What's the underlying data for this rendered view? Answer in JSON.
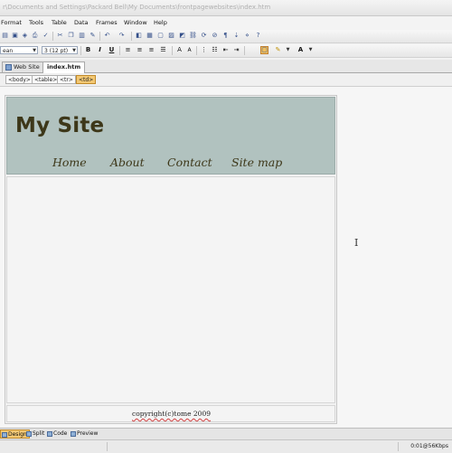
{
  "window": {
    "title": "r\\Documents and Settings\\Packard Bell\\My Documents\\frontpagewebsites\\index.htm"
  },
  "menu": {
    "items": [
      "Format",
      "Tools",
      "Table",
      "Data",
      "Frames",
      "Window",
      "Help"
    ]
  },
  "format_toolbar": {
    "style_value": "ean",
    "size_value": "3 (12 pt)",
    "bold": "B",
    "italic": "I",
    "underline": "U"
  },
  "tabs": [
    {
      "label": "Web Site"
    },
    {
      "label": "index.htm"
    }
  ],
  "tag_selector": [
    "<body>",
    "<table>",
    "<tr>",
    "<td>"
  ],
  "page": {
    "site_title": "My Site",
    "nav": [
      "Home",
      "About",
      "Contact",
      "Site map"
    ],
    "footer": "copyright(c)tome 2009"
  },
  "view_buttons": [
    "Design",
    "Split",
    "Code",
    "Preview"
  ],
  "status": {
    "speed": "0:01@56Kbps"
  },
  "colors": {
    "banner": "#b1c2bf",
    "site_text": "#3d3719",
    "highlight": "#f3c873"
  }
}
